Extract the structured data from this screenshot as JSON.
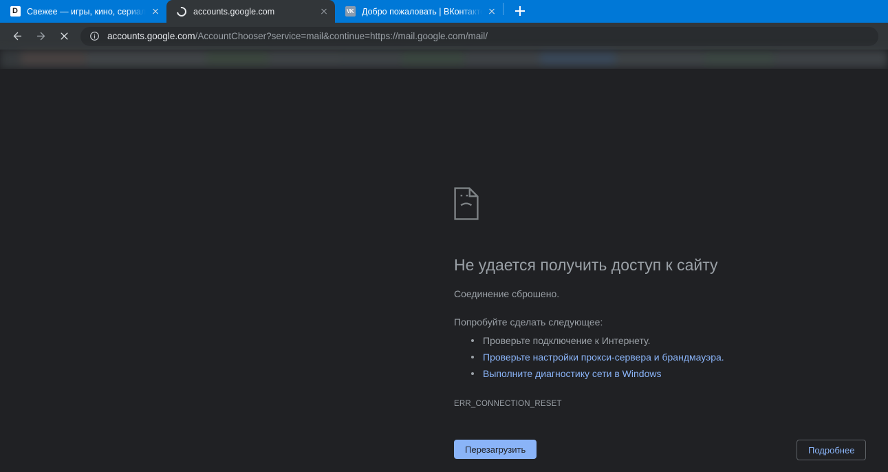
{
  "browser": {
    "tabs": [
      {
        "title": "Свежее — игры, кино, сериалы",
        "favicon": "dzen-favicon",
        "favicon_glyph": "D",
        "active": false,
        "loading": false,
        "close_label": "×"
      },
      {
        "title": "accounts.google.com",
        "favicon": "loading-spinner-icon",
        "favicon_glyph": "",
        "active": true,
        "loading": true,
        "close_label": "×"
      },
      {
        "title": "Добро пожаловать | ВКонтакте",
        "favicon": "vk-favicon",
        "favicon_glyph": "VK",
        "active": false,
        "loading": false,
        "close_label": "×"
      }
    ],
    "new_tab_label": "+",
    "toolbar": {
      "back_icon": "back-arrow-icon",
      "forward_icon": "forward-arrow-icon",
      "stop_icon": "stop-loading-icon",
      "info_icon": "info-circle-icon"
    },
    "omnibox": {
      "host": "accounts.google.com",
      "path": "/AccountChooser?service=mail&continue=https://mail.google.com/mail/",
      "full_url": "accounts.google.com/AccountChooser?service=mail&continue=https://mail.google.com/mail/"
    }
  },
  "error_page": {
    "icon": "sad-page-icon",
    "title": "Не удается получить доступ к сайту",
    "subtitle": "Соединение сброшено.",
    "suggestions_heading": "Попробуйте сделать следующее:",
    "suggestions": [
      {
        "text": "Проверьте подключение к Интернету.",
        "is_link": false
      },
      {
        "text": "Проверьте настройки прокси-сервера и брандмауэра.",
        "is_link": true
      },
      {
        "text": "Выполните диагностику сети в Windows",
        "is_link": true
      }
    ],
    "error_code": "ERR_CONNECTION_RESET",
    "reload_button": "Перезагрузить",
    "details_button": "Подробнее"
  },
  "colors": {
    "tabstrip_blue": "#0078d7",
    "toolbar_gray": "#323639",
    "page_background": "#202124",
    "link_blue": "#8ab4f8",
    "text_gray": "#9aa0a6",
    "reload_button_bg": "#8ab4f8"
  }
}
